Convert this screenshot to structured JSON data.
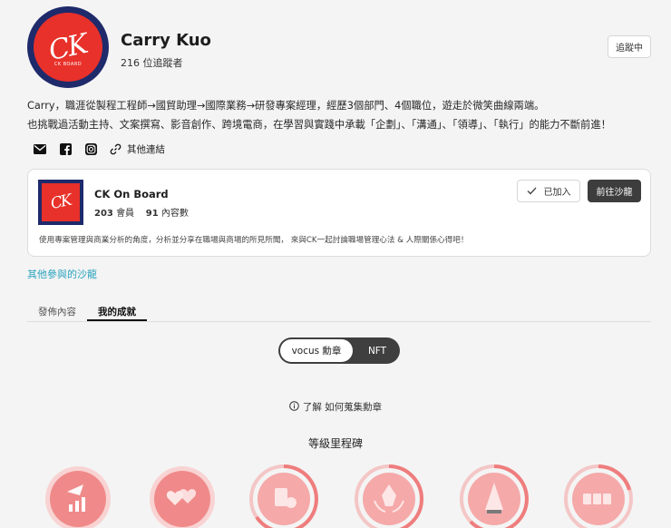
{
  "profile": {
    "name": "Carry Kuo",
    "followers": "216 位追蹤者",
    "follow_label": "追蹤中",
    "avatar_logo_sub": "CK BOARD",
    "bio_line1": "Carry，職涯從製程工程師→國貿助理→國際業務→研發專案經理，經歷3個部門、4個職位，遊走於微笑曲線兩端。",
    "bio_line2": "也挑戰過活動主持、文案撰寫、影音創作、跨境電商，在學習與實踐中承載「企劃」、「溝通」、「領導」、「執行」的能力不斷前進！",
    "other_links": "其他連結",
    "social_icons": [
      "mail-icon",
      "facebook-icon",
      "instagram-icon"
    ]
  },
  "community": {
    "title": "CK On Board",
    "members_count": "203",
    "members_label": "會員",
    "content_count": "91",
    "content_label": "內容數",
    "joined_label": "已加入",
    "go_label": "前往沙龍",
    "description": "使用專案管理與商業分析的角度，分析並分享在職場與商場的所見所聞， 來與CK一起討論職場管理心法 & 人際關係心得吧！"
  },
  "other_salons": "其他參與的沙龍",
  "tabs": [
    {
      "label": "發佈內容",
      "active": false
    },
    {
      "label": "我的成就",
      "active": true
    }
  ],
  "toggle": {
    "active": "vocus 勳章",
    "inactive": "NFT"
  },
  "how_collect": "了解 如何蒐集勳章",
  "milestone_title": "等級里程碑",
  "badges": [
    {
      "icon": "rocket-chart-icon",
      "progress": 1.0
    },
    {
      "icon": "hearts-icon",
      "progress": 1.0
    },
    {
      "icon": "coins-icon",
      "progress": 0.7
    },
    {
      "icon": "pen-nib-icon",
      "progress": 0.5
    },
    {
      "icon": "trophy-icon",
      "progress": 0.6
    },
    {
      "icon": "cards-icon",
      "progress": 0.3
    }
  ],
  "colors": {
    "accent_link": "#2aa3bd",
    "badge_pink": "#f08a8a",
    "dark_button": "#3d3d3d",
    "brand_red": "#e8312a",
    "brand_navy": "#1f2a6b"
  }
}
